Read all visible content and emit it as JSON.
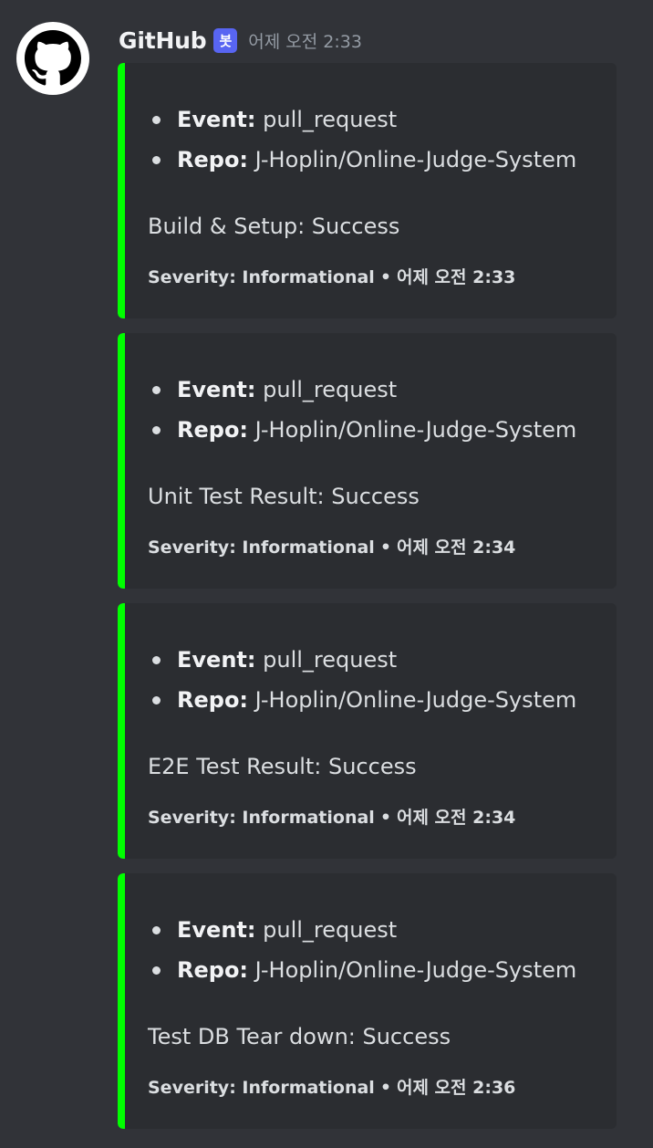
{
  "message": {
    "author": "GitHub",
    "bot_tag": "봇",
    "timestamp": "어제 오전 2:33",
    "avatar_icon": "github-icon"
  },
  "colors": {
    "embed_bar": "#00ff00",
    "bot_tag": "#5865f2",
    "background": "#313338",
    "embed_background": "#2b2d31"
  },
  "embeds": [
    {
      "fields": [
        {
          "key": "Event:",
          "value": "pull_request"
        },
        {
          "key": "Repo:",
          "value": "J-Hoplin/Online-Judge-System"
        }
      ],
      "description": "Build & Setup: Success",
      "footer_text": "Severity: Informational",
      "footer_separator": "•",
      "footer_time": "어제 오전 2:33"
    },
    {
      "fields": [
        {
          "key": "Event:",
          "value": "pull_request"
        },
        {
          "key": "Repo:",
          "value": "J-Hoplin/Online-Judge-System"
        }
      ],
      "description": "Unit Test Result: Success",
      "footer_text": "Severity: Informational",
      "footer_separator": "•",
      "footer_time": "어제 오전 2:34"
    },
    {
      "fields": [
        {
          "key": "Event:",
          "value": "pull_request"
        },
        {
          "key": "Repo:",
          "value": "J-Hoplin/Online-Judge-System"
        }
      ],
      "description": "E2E Test Result: Success",
      "footer_text": "Severity: Informational",
      "footer_separator": "•",
      "footer_time": "어제 오전 2:34"
    },
    {
      "fields": [
        {
          "key": "Event:",
          "value": "pull_request"
        },
        {
          "key": "Repo:",
          "value": "J-Hoplin/Online-Judge-System"
        }
      ],
      "description": "Test DB Tear down: Success",
      "footer_text": "Severity: Informational",
      "footer_separator": "•",
      "footer_time": "어제 오전 2:36"
    }
  ]
}
